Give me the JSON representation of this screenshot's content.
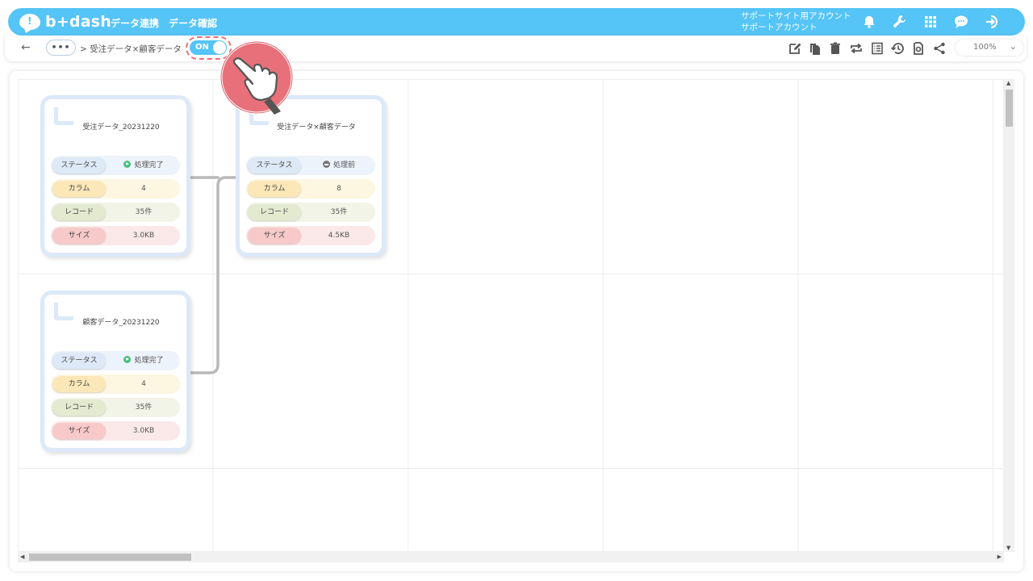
{
  "header": {
    "logo_mark": "!",
    "logo_text": "b+dash",
    "nav": [
      {
        "label": "データ連携"
      },
      {
        "label": "データ確認"
      }
    ],
    "account_line1": "サポートサイト用アカウント",
    "account_line2": "サポートアカウント",
    "icons": [
      "bell-icon",
      "wrench-icon",
      "apps-grid-icon",
      "chat-icon",
      "logout-icon"
    ]
  },
  "toolbar": {
    "back_label": "←",
    "more_label": "•••",
    "breadcrumb": "> 受注データ×顧客データ",
    "toggle_label": "ON",
    "zoom_value": "100%",
    "zoom_chevron": "⌄",
    "icons": [
      "edit-icon",
      "copy-icon",
      "delete-icon",
      "repeat-icon",
      "list-icon",
      "history-icon",
      "refresh-icon",
      "share-icon"
    ]
  },
  "cards": [
    {
      "title": "受注データ_20231220",
      "rows": [
        {
          "label": "ステータス",
          "value": "処理完了",
          "status": "done"
        },
        {
          "label": "カラム",
          "value": "4"
        },
        {
          "label": "レコード",
          "value": "35件"
        },
        {
          "label": "サイズ",
          "value": "3.0KB"
        }
      ]
    },
    {
      "title": "受注データ×顧客データ",
      "rows": [
        {
          "label": "ステータス",
          "value": "処理前",
          "status": "pending"
        },
        {
          "label": "カラム",
          "value": "8"
        },
        {
          "label": "レコード",
          "value": "35件"
        },
        {
          "label": "サイズ",
          "value": "4.5KB"
        }
      ]
    },
    {
      "title": "顧客データ_20231220",
      "rows": [
        {
          "label": "ステータス",
          "value": "処理完了",
          "status": "done"
        },
        {
          "label": "カラム",
          "value": "4"
        },
        {
          "label": "レコード",
          "value": "35件"
        },
        {
          "label": "サイズ",
          "value": "3.0KB"
        }
      ]
    }
  ],
  "colors": {
    "accent": "#55c4f6",
    "highlight": "#e8707a",
    "status_done": "#46c07e",
    "status_pending": "#777777"
  }
}
